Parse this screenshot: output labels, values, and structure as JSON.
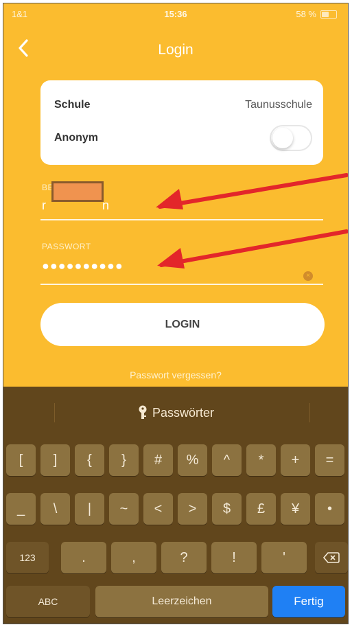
{
  "status_bar": {
    "carrier": "1&1",
    "time": "15:36",
    "battery": "58 %",
    "battery_level": 0.58
  },
  "nav": {
    "title": "Login",
    "back_icon": "chevron-left-icon"
  },
  "school_card": {
    "school_label": "Schule",
    "school_value": "Taunusschule",
    "anonym_label": "Anonym",
    "anonym_on": false
  },
  "form": {
    "user_label": "BENUTZER",
    "user_value_prefix": "r",
    "user_value_suffix": "n",
    "password_label": "PASSWORT",
    "password_value": "●●●●●●●●●●",
    "login_button": "LOGIN",
    "forgot_link": "Passwort vergessen?"
  },
  "keyboard": {
    "suggestion": "Passwörter",
    "suggestion_icon": "key-icon",
    "row1": [
      "[",
      "]",
      "{",
      "}",
      "#",
      "%",
      "^",
      "*",
      "+",
      "="
    ],
    "row2": [
      "_",
      "\\",
      "|",
      "~",
      "<",
      ">",
      "$",
      "£",
      "¥",
      "•"
    ],
    "row3": [
      ".",
      ",",
      "?",
      "!",
      "'"
    ],
    "key_123": "123",
    "key_abc": "ABC",
    "key_space": "Leerzeichen",
    "key_done": "Fertig",
    "backspace_icon": "backspace-icon"
  },
  "colors": {
    "background": "#fbbc2f",
    "keyboard": "#61461c",
    "done_key": "#1f80f4",
    "annotation_arrow": "#e3262a"
  }
}
